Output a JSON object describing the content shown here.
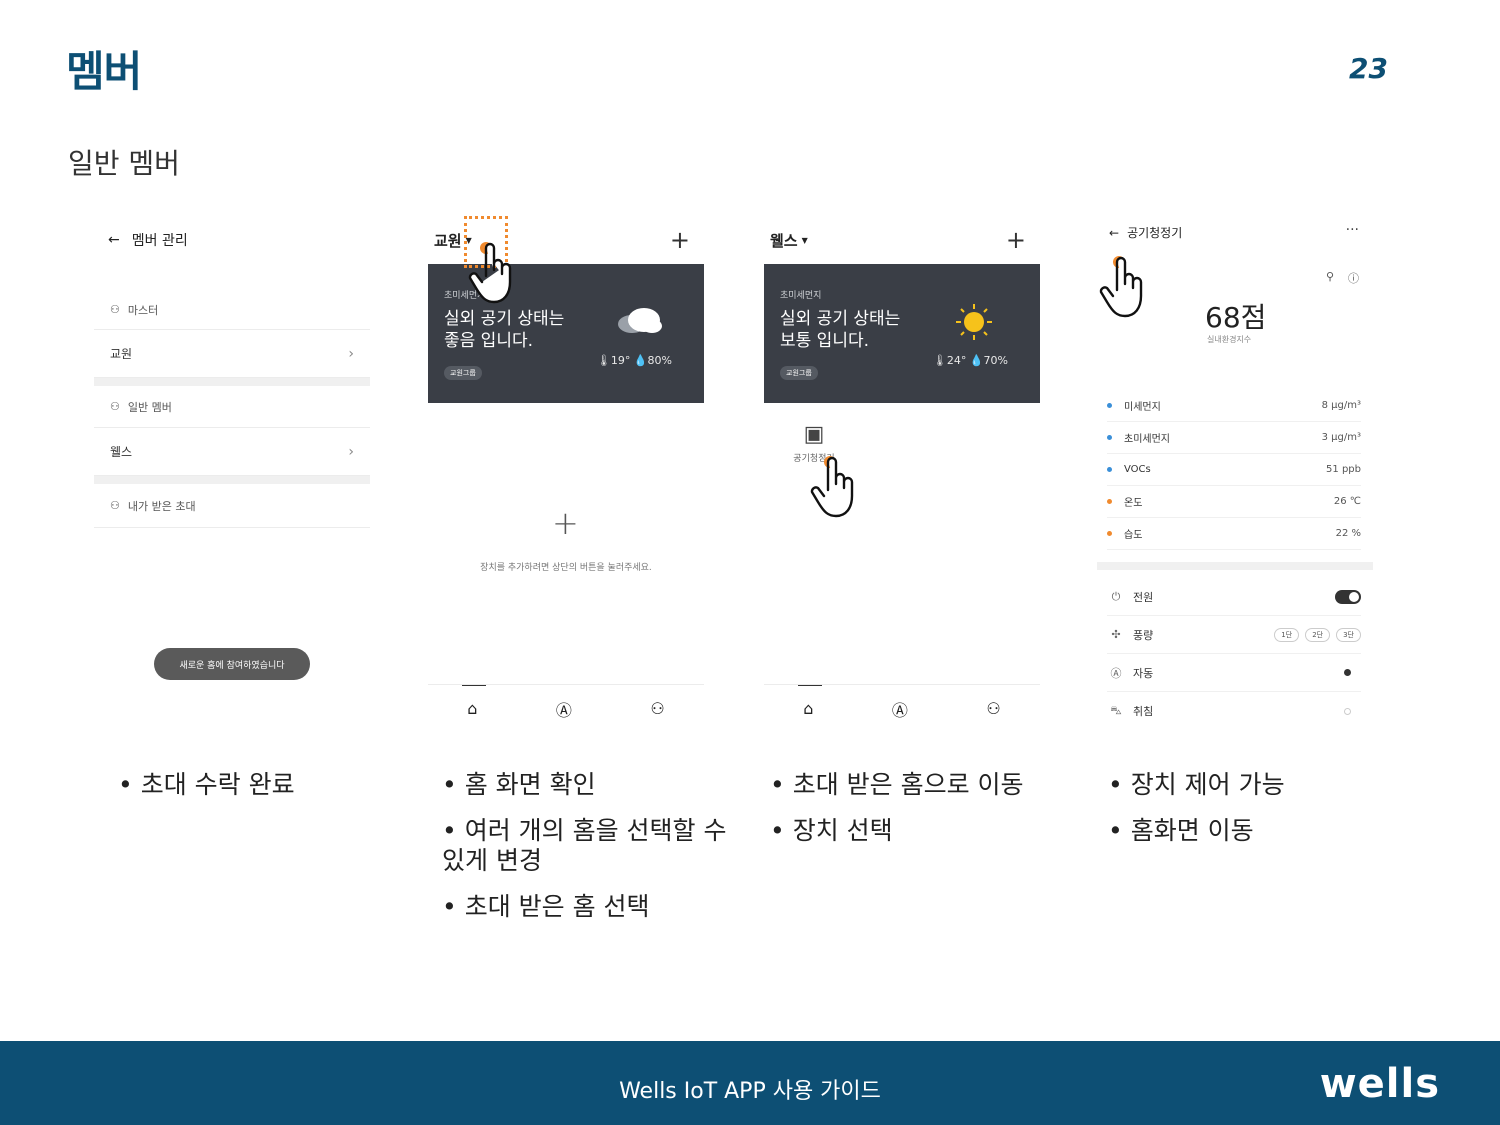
{
  "page": {
    "title": "멤버",
    "number": "23",
    "subtitle": "일반 멤버"
  },
  "screen1": {
    "header": "멤버 관리",
    "master_label": "마스터",
    "home1": "교원",
    "general_label": "일반 멤버",
    "home2": "웰스",
    "invites_label": "내가 받은 초대",
    "toast": "새로운 홈에 참여하였습니다"
  },
  "screen2": {
    "home_name": "교원",
    "card_label": "초미세먼지",
    "card_status": "실외 공기 상태는\n좋음 입니다.",
    "group_tag": "교원그룹",
    "weather": "🌡19°  💧80%",
    "empty_message": "장치를 추가하려면 상단의 버튼을 눌러주세요."
  },
  "screen3": {
    "home_name": "웰스",
    "card_label": "초미세먼지",
    "card_status": "실외 공기 상태는\n보통 입니다.",
    "group_tag": "교원그룹",
    "weather": "🌡24°  💧70%",
    "device_label": "공기청정기"
  },
  "screen4": {
    "header": "공기청정기",
    "score": "68점",
    "score_sub": "실내환경지수",
    "metrics": [
      {
        "name": "미세먼지",
        "value": "8 μg/m³",
        "color": "#3a8fd8"
      },
      {
        "name": "초미세먼지",
        "value": "3 μg/m³",
        "color": "#3a8fd8"
      },
      {
        "name": "VOCs",
        "value": "51 ppb",
        "color": "#3a8fd8"
      },
      {
        "name": "온도",
        "value": "26 ℃",
        "color": "#f08a2e"
      },
      {
        "name": "습도",
        "value": "22 %",
        "color": "#f08a2e"
      }
    ],
    "controls": {
      "power": "전원",
      "airflow": "풍량",
      "speed1": "1단",
      "speed2": "2단",
      "speed3": "3단",
      "auto": "자동",
      "sleep": "취침"
    }
  },
  "captions": {
    "c1": [
      "초대 수락 완료"
    ],
    "c2": [
      "홈 화면 확인",
      "여러 개의 홈을 선택할 수 있게 변경",
      "초대 받은 홈 선택"
    ],
    "c3": [
      "초대 받은 홈으로 이동",
      "장치 선택"
    ],
    "c4": [
      "장치 제어 가능",
      "홈화면 이동"
    ]
  },
  "footer": {
    "text": "Wells IoT APP 사용 가이드",
    "logo": "wells"
  },
  "colors": {
    "brand": "#0d4f74",
    "accent": "#f08a2e",
    "card": "#3a3e46"
  }
}
